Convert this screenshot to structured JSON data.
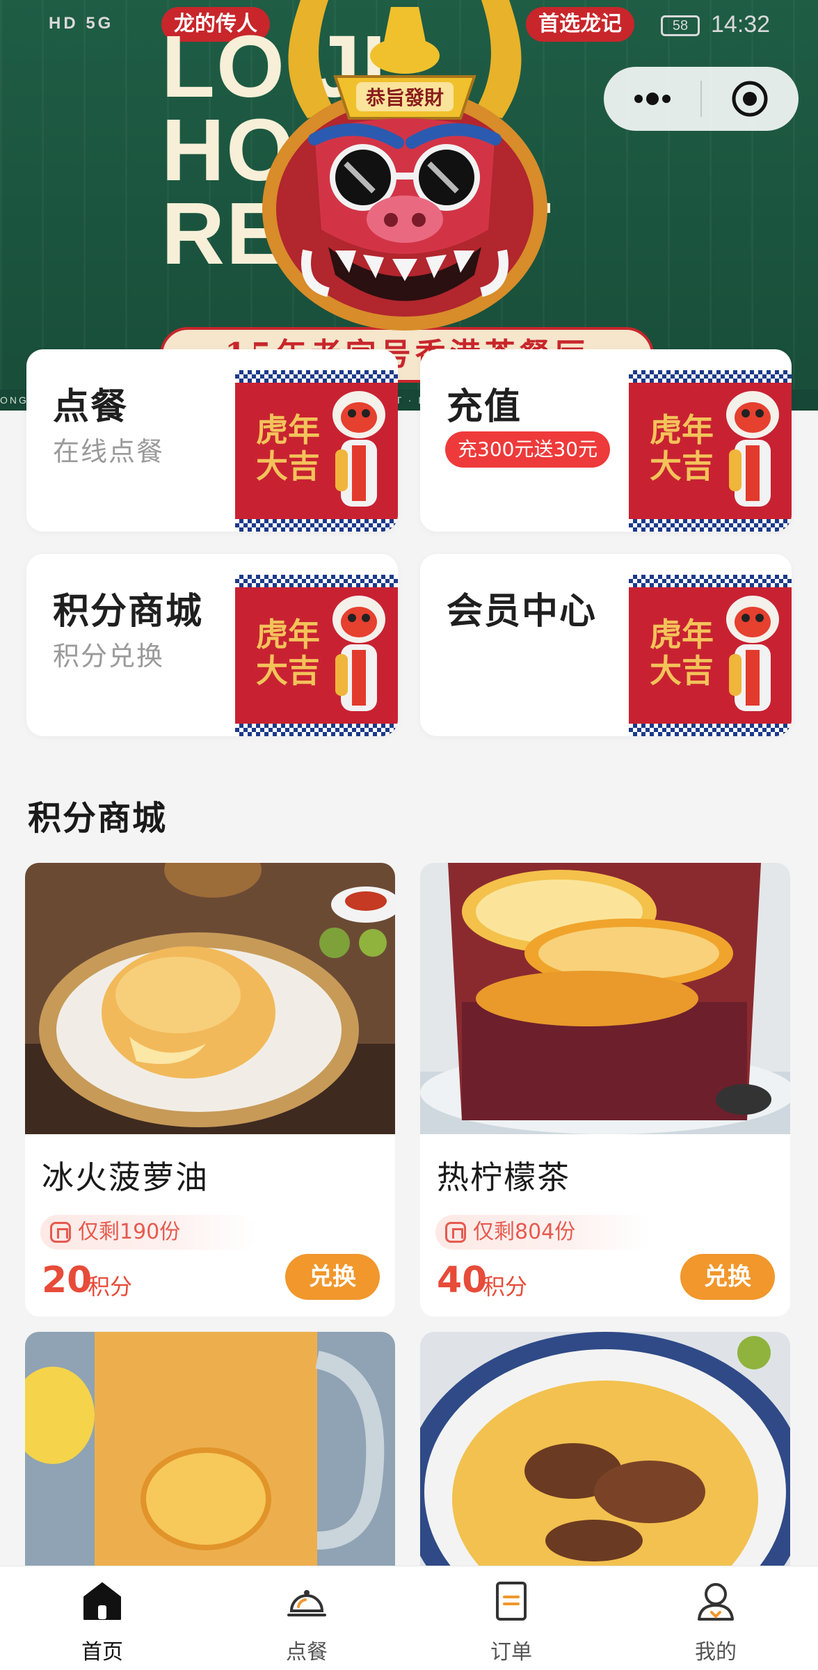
{
  "status_bar": {
    "left_text": "HD 5G",
    "battery": "58",
    "time": "14:32"
  },
  "hero": {
    "tag_left": "龙的传人",
    "tag_right": "首选龙记",
    "title_lines": [
      "LO     JI",
      "HO           NG",
      "RES          ANT"
    ],
    "crown_text": "恭旨發財",
    "ribbon_text": "15年老字号香港茶餐厅",
    "strip_text": "ONG KONG RESTAURANT · LONG JI HONG KONG RESTAURANT · LONG JI HONG KONG RESTAURANT · RES"
  },
  "capsule": {
    "more_icon": "more-icon",
    "close_icon": "target-icon"
  },
  "features": [
    {
      "title": "点餐",
      "subtitle": "在线点餐",
      "badge": ""
    },
    {
      "title": "充值",
      "subtitle": "",
      "badge": "充300元送30元"
    },
    {
      "title": "积分商城",
      "subtitle": "积分兑换",
      "badge": ""
    },
    {
      "title": "会员中心",
      "subtitle": "",
      "badge": ""
    }
  ],
  "feature_image_text": "虎年大吉",
  "section": {
    "title": "积分商城"
  },
  "products": [
    {
      "name": "冰火菠萝油",
      "stock": "仅剩190份",
      "points": "20",
      "points_unit": "积分",
      "button": "兑换"
    },
    {
      "name": "热柠檬茶",
      "stock": "仅剩804份",
      "points": "40",
      "points_unit": "积分",
      "button": "兑换"
    },
    {
      "name": "",
      "stock": "",
      "points": "",
      "points_unit": "",
      "button": ""
    },
    {
      "name": "",
      "stock": "",
      "points": "",
      "points_unit": "",
      "button": ""
    }
  ],
  "tabbar": [
    {
      "label": "首页",
      "icon": "home-icon",
      "active": true
    },
    {
      "label": "点餐",
      "icon": "cloche-icon",
      "active": false
    },
    {
      "label": "订单",
      "icon": "order-icon",
      "active": false
    },
    {
      "label": "我的",
      "icon": "user-icon",
      "active": false
    }
  ],
  "colors": {
    "hero_green": "#1f5d45",
    "accent_orange": "#f1972c",
    "points_red": "#e74b39",
    "badge_red": "#ee3a3a"
  }
}
